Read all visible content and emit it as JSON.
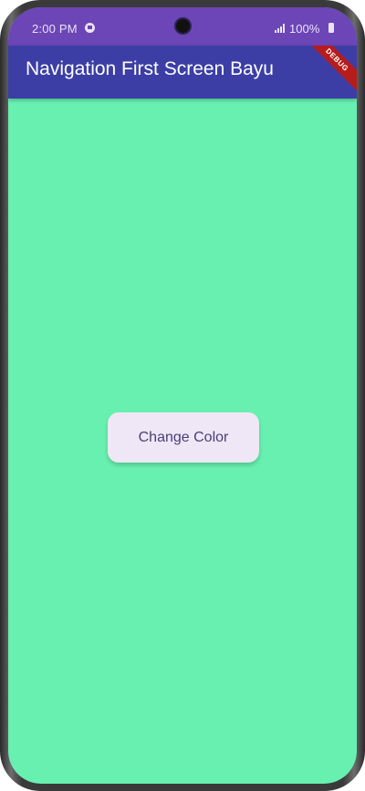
{
  "status_bar": {
    "time": "2:00 PM",
    "battery": "100%",
    "message_icon": "message-icon",
    "signal_icon": "signal-icon",
    "battery_icon": "battery-icon"
  },
  "app_bar": {
    "title": "Navigation First Screen Bayu",
    "debug_banner": "DEBUG"
  },
  "body": {
    "button_label": "Change Color",
    "background_color": "#68f0b0"
  },
  "colors": {
    "status_bar": "#6c45b7",
    "app_bar": "#3c3ea6",
    "button": "#efe7f5",
    "button_text": "#4a3e79"
  }
}
